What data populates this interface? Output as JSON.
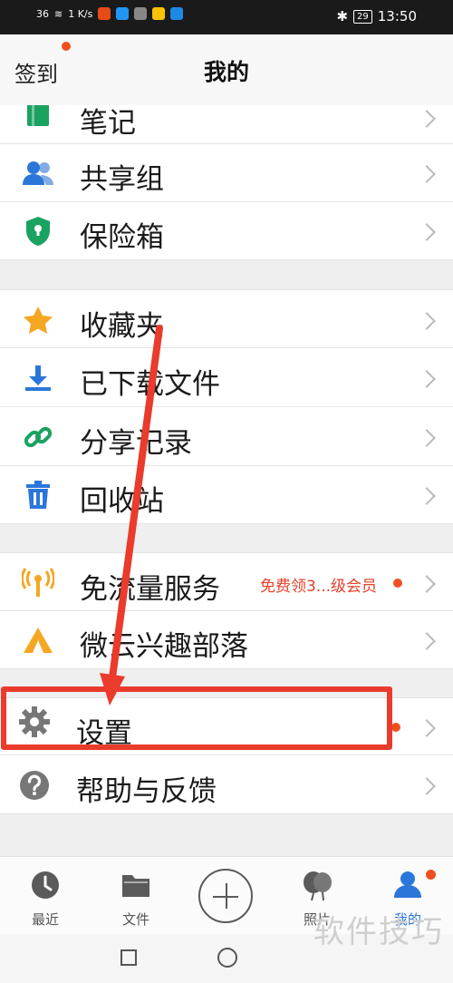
{
  "status_bar": {
    "network": "36",
    "speed": "1 K/s",
    "battery": "29",
    "time": "13:50"
  },
  "header": {
    "signin_label": "签到",
    "title": "我的"
  },
  "sections": [
    {
      "items": [
        {
          "label": "笔记",
          "icon": "note-icon"
        },
        {
          "label": "共享组",
          "icon": "group-icon"
        },
        {
          "label": "保险箱",
          "icon": "shield-lock-icon"
        }
      ]
    },
    {
      "items": [
        {
          "label": "收藏夹",
          "icon": "star-icon"
        },
        {
          "label": "已下载文件",
          "icon": "download-icon"
        },
        {
          "label": "分享记录",
          "icon": "link-icon"
        },
        {
          "label": "回收站",
          "icon": "trash-icon"
        }
      ]
    },
    {
      "items": [
        {
          "label": "免流量服务",
          "icon": "signal-icon",
          "promo": "免费领3...级会员"
        },
        {
          "label": "微云兴趣部落",
          "icon": "tent-icon"
        }
      ]
    },
    {
      "items": [
        {
          "label": "设置",
          "icon": "gear-icon"
        },
        {
          "label": "帮助与反馈",
          "icon": "question-icon"
        }
      ]
    }
  ],
  "bottom_nav": [
    {
      "label": "最近",
      "icon": "clock-icon"
    },
    {
      "label": "文件",
      "icon": "folder-icon"
    },
    {
      "label": "",
      "icon": "plus-icon"
    },
    {
      "label": "照片",
      "icon": "balloon-icon"
    },
    {
      "label": "我的",
      "icon": "user-icon",
      "active": true
    }
  ],
  "watermark": "软件技巧",
  "colors": {
    "blue": "#2b77d9",
    "green": "#1aa260",
    "orange": "#f5a623",
    "red": "#ea3b2c",
    "gray": "#777777"
  }
}
